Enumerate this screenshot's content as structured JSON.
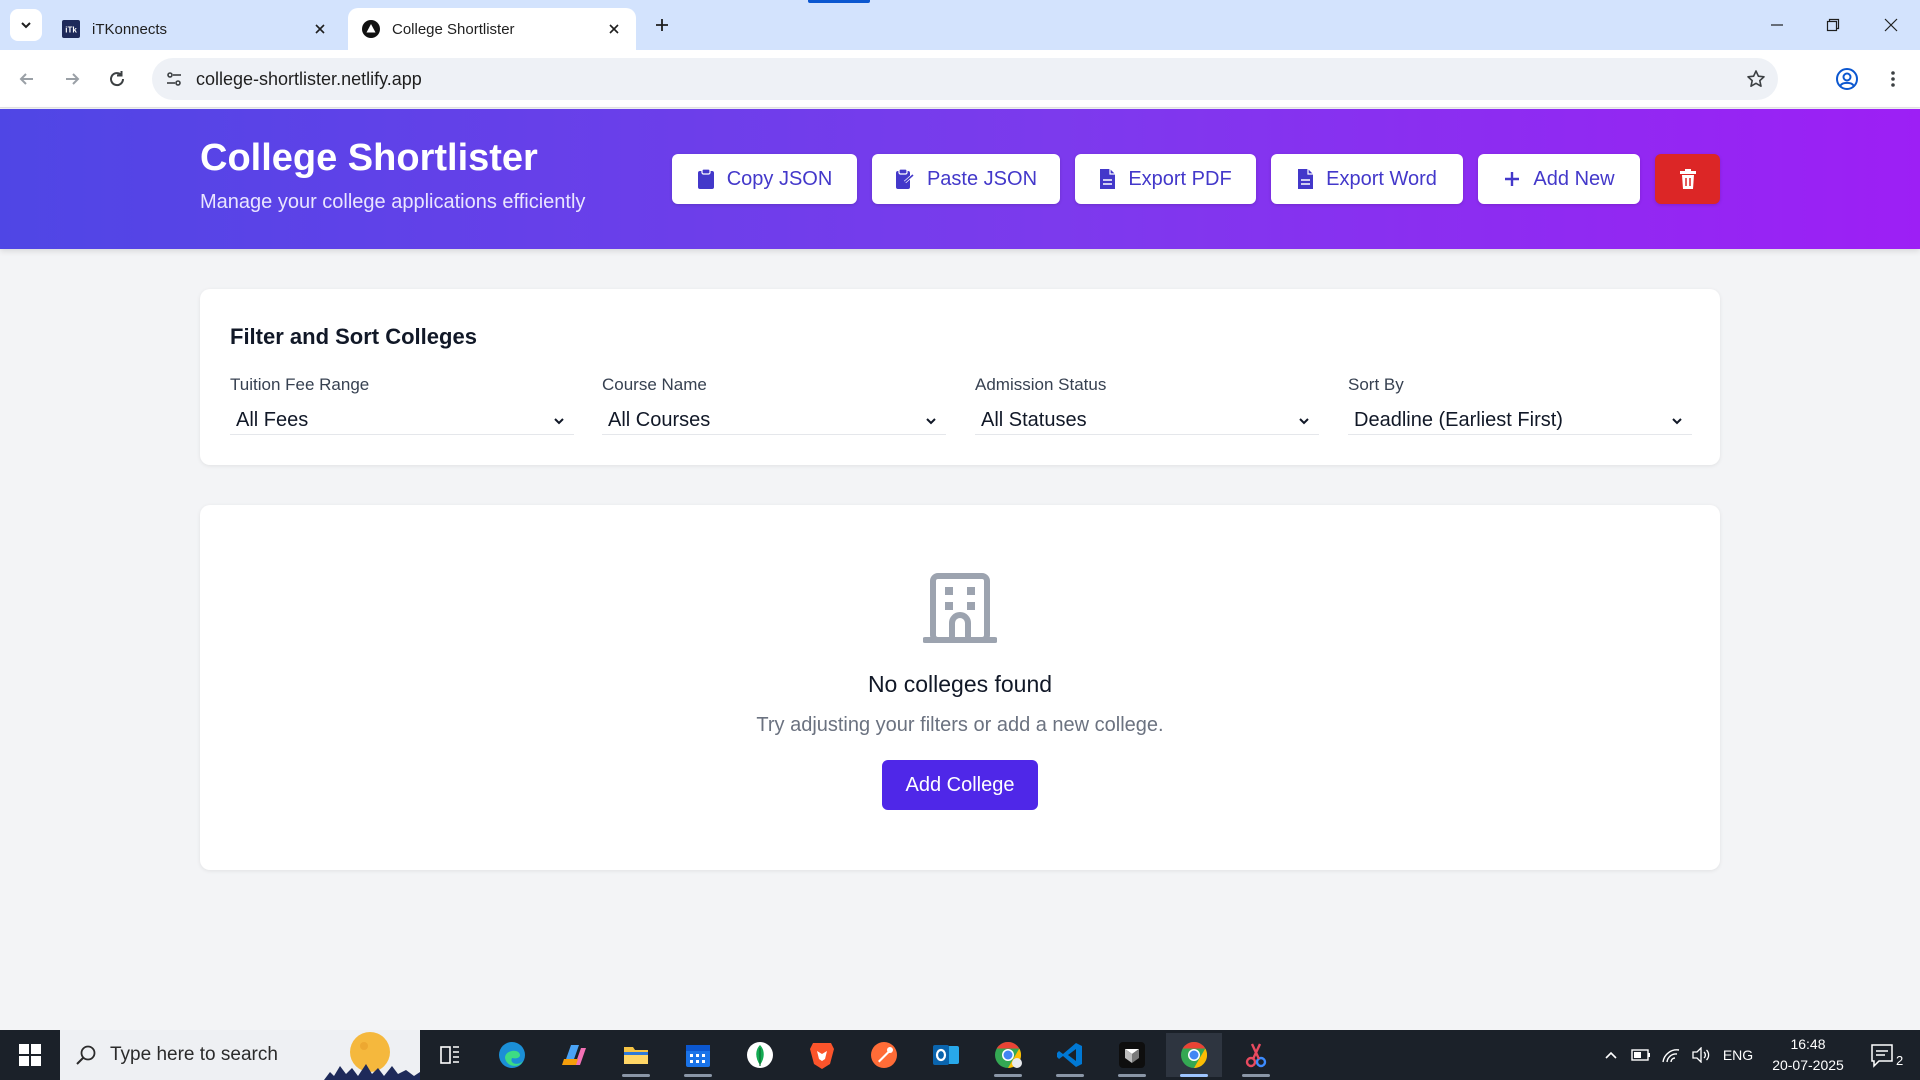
{
  "browser": {
    "tabs": [
      {
        "title": "iTKonnects",
        "favicon_text": "iTk"
      },
      {
        "title": "College Shortlister"
      }
    ],
    "url": "college-shortlister.netlify.app"
  },
  "header": {
    "title": "College Shortlister",
    "subtitle": "Manage your college applications efficiently",
    "buttons": {
      "copy_json": "Copy JSON",
      "paste_json": "Paste JSON",
      "export_pdf": "Export PDF",
      "export_word": "Export Word",
      "add_new": "Add New"
    }
  },
  "filters": {
    "title": "Filter and Sort Colleges",
    "tuition": {
      "label": "Tuition Fee Range",
      "value": "All Fees"
    },
    "course": {
      "label": "Course Name",
      "value": "All Courses"
    },
    "status": {
      "label": "Admission Status",
      "value": "All Statuses"
    },
    "sort": {
      "label": "Sort By",
      "value": "Deadline (Earliest First)"
    }
  },
  "empty_state": {
    "title": "No colleges found",
    "subtitle": "Try adjusting your filters or add a new college.",
    "button": "Add College"
  },
  "taskbar": {
    "search_placeholder": "Type here to search",
    "language": "ENG",
    "time": "16:48",
    "date": "20-07-2025",
    "notifications": "2"
  },
  "colors": {
    "header_gradient_start": "#4f46e5",
    "header_gradient_end": "#9d1ff5",
    "primary": "#4f27e8",
    "danger": "#dc2626"
  }
}
